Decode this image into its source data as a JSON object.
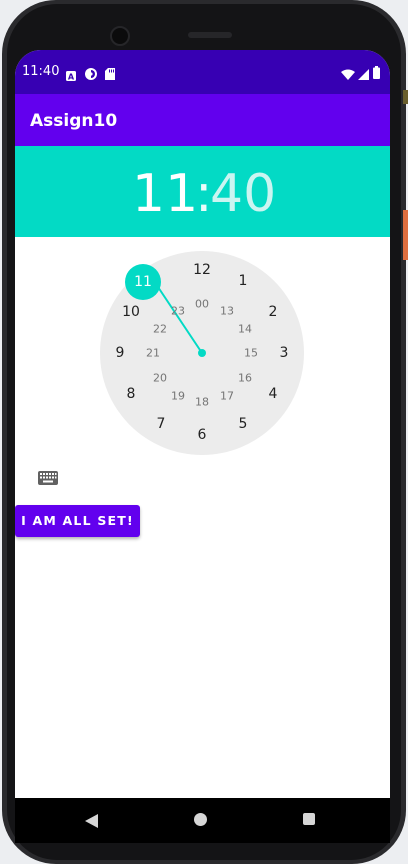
{
  "status_bar": {
    "time": "11:40",
    "icons": [
      "a-icon",
      "circle-app-icon",
      "sd-card-icon",
      "wifi-icon",
      "signal-icon",
      "battery-icon"
    ]
  },
  "app_bar": {
    "title": "Assign10"
  },
  "time_display": {
    "hour": "11",
    "separator": ":",
    "minute": "40"
  },
  "clock_face": {
    "selected_hour": "11",
    "outer_numbers": [
      "12",
      "1",
      "2",
      "3",
      "4",
      "5",
      "6",
      "7",
      "8",
      "9",
      "10",
      "11"
    ],
    "inner_numbers": [
      "00",
      "13",
      "14",
      "15",
      "16",
      "17",
      "18",
      "19",
      "20",
      "21",
      "22",
      "23"
    ]
  },
  "keyboard_toggle": {
    "icon": "keyboard-icon"
  },
  "confirm_button": {
    "label": "I AM ALL SET!"
  },
  "nav_bar": {
    "icons": [
      "back-icon",
      "home-icon",
      "recents-icon"
    ]
  },
  "colors": {
    "status_bar": "#3700b3",
    "app_bar": "#6200ee",
    "accent": "#03dac5",
    "button": "#6200ee"
  }
}
